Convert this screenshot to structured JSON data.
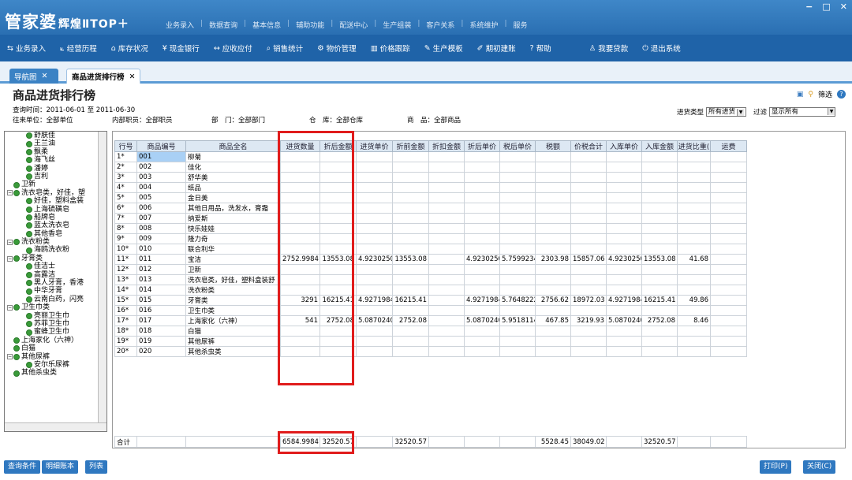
{
  "app": {
    "logo_main": "管家婆",
    "logo_sub": "辉煌ⅡTOP＋",
    "window_controls": [
      "−",
      "□",
      "✕"
    ]
  },
  "top_menu": [
    "业务录入",
    "数据查询",
    "基本信息",
    "辅助功能",
    "配送中心",
    "生产组装",
    "客户关系",
    "系统维护",
    "服务"
  ],
  "toolbar": [
    {
      "icon": "transfer-icon",
      "glyph": "⇆",
      "label": "业务录入"
    },
    {
      "icon": "chart-icon",
      "glyph": "⟀",
      "label": "经营历程"
    },
    {
      "icon": "home-icon",
      "glyph": "⌂",
      "label": "库存状况"
    },
    {
      "icon": "yen-icon",
      "glyph": "¥",
      "label": "现金银行"
    },
    {
      "icon": "arrows-icon",
      "glyph": "↔",
      "label": "应收应付"
    },
    {
      "icon": "search-icon",
      "glyph": "⌕",
      "label": "销售统计"
    },
    {
      "icon": "gear-icon",
      "glyph": "⚙",
      "label": "物价管理"
    },
    {
      "icon": "bar-chart-icon",
      "glyph": "▥",
      "label": "价格跟踪"
    },
    {
      "icon": "wrench-icon",
      "glyph": "✎",
      "label": "生产模板"
    },
    {
      "icon": "edit-icon",
      "glyph": "✐",
      "label": "期初建账"
    },
    {
      "icon": "help-icon",
      "glyph": "?",
      "label": "帮助"
    },
    {
      "icon": "user-icon",
      "glyph": "♙",
      "label": "我要贷款"
    },
    {
      "icon": "power-icon",
      "glyph": "⏻",
      "label": "退出系统"
    }
  ],
  "tabs": [
    {
      "label": "导航图",
      "close": "✕"
    },
    {
      "label": "商品进货排行榜",
      "close": "✕"
    }
  ],
  "page": {
    "title": "商品进货排行榜",
    "query_time": "查询时间：2011-06-01 至 2011-06-30",
    "partner": "往来单位：全部单位",
    "staff": "内部职员：全部职员",
    "dept": "部　门：全部部门",
    "warehouse": "仓　库：全部仓库",
    "goods": "商　品：全部商品",
    "filter_label": "筛选",
    "purchase_type_label": "进货类型",
    "purchase_type_value": "所有进货",
    "filter2_label": "过滤",
    "filter2_value": "显示所有"
  },
  "tree": [
    {
      "label": "舒肤佳",
      "indent": 3
    },
    {
      "label": "王兰油",
      "indent": 3
    },
    {
      "label": "飘柔",
      "indent": 3
    },
    {
      "label": "海飞丝",
      "indent": 3
    },
    {
      "label": "潘婷",
      "indent": 3
    },
    {
      "label": "吉利",
      "indent": 3
    },
    {
      "label": "卫新",
      "indent": 1
    },
    {
      "label": "洗衣皂类，好佳，塑",
      "indent": 0,
      "exp": "−"
    },
    {
      "label": "好佳，塑料盒装",
      "indent": 3
    },
    {
      "label": "上海硫磺皂",
      "indent": 3
    },
    {
      "label": "船牌皂",
      "indent": 3
    },
    {
      "label": "蓝太洗衣皂",
      "indent": 3
    },
    {
      "label": "其他香皂",
      "indent": 3
    },
    {
      "label": "洗衣粉类",
      "indent": 0,
      "exp": "−"
    },
    {
      "label": "海鸥洗衣粉",
      "indent": 3
    },
    {
      "label": "牙膏类",
      "indent": 0,
      "exp": "−"
    },
    {
      "label": "佳洁士",
      "indent": 3
    },
    {
      "label": "高露洁",
      "indent": 3
    },
    {
      "label": "黑人牙膏，香港",
      "indent": 3
    },
    {
      "label": "中华牙膏",
      "indent": 3
    },
    {
      "label": "云南白药，闪亮",
      "indent": 3
    },
    {
      "label": "卫生巾类",
      "indent": 0,
      "exp": "−"
    },
    {
      "label": "亮丽卫生巾",
      "indent": 3
    },
    {
      "label": "苏菲卫生巾",
      "indent": 3
    },
    {
      "label": "蜜蜂卫生巾",
      "indent": 3
    },
    {
      "label": "上海家化（六神）",
      "indent": 1
    },
    {
      "label": "白猫",
      "indent": 1
    },
    {
      "label": "其他尿裤",
      "indent": 0,
      "exp": "−"
    },
    {
      "label": "安尔乐尿裤",
      "indent": 3
    },
    {
      "label": "其他杀虫类",
      "indent": 1
    }
  ],
  "grid": {
    "columns": [
      "行号",
      "商品编号",
      "商品全名",
      "进货数量",
      "折后金额",
      "进货单价",
      "折前金额",
      "折扣金额",
      "折后单价",
      "税后单价",
      "税额",
      "价税合计",
      "入库单价",
      "入库金额",
      "进货比重(",
      "运费"
    ],
    "rows": [
      [
        "1*",
        "001",
        "柳菊",
        "",
        "",
        "",
        "",
        "",
        "",
        "",
        "",
        "",
        "",
        "",
        "",
        ""
      ],
      [
        "2*",
        "002",
        "佳化",
        "",
        "",
        "",
        "",
        "",
        "",
        "",
        "",
        "",
        "",
        "",
        "",
        ""
      ],
      [
        "3*",
        "003",
        "舒华美",
        "",
        "",
        "",
        "",
        "",
        "",
        "",
        "",
        "",
        "",
        "",
        "",
        ""
      ],
      [
        "4*",
        "004",
        "纸品",
        "",
        "",
        "",
        "",
        "",
        "",
        "",
        "",
        "",
        "",
        "",
        "",
        ""
      ],
      [
        "5*",
        "005",
        "金日美",
        "",
        "",
        "",
        "",
        "",
        "",
        "",
        "",
        "",
        "",
        "",
        "",
        ""
      ],
      [
        "6*",
        "006",
        "其他日用品，洗发水，膏霜",
        "",
        "",
        "",
        "",
        "",
        "",
        "",
        "",
        "",
        "",
        "",
        "",
        ""
      ],
      [
        "7*",
        "007",
        "纳爱斯",
        "",
        "",
        "",
        "",
        "",
        "",
        "",
        "",
        "",
        "",
        "",
        "",
        ""
      ],
      [
        "8*",
        "008",
        "快乐娃娃",
        "",
        "",
        "",
        "",
        "",
        "",
        "",
        "",
        "",
        "",
        "",
        "",
        ""
      ],
      [
        "9*",
        "009",
        "隆力奇",
        "",
        "",
        "",
        "",
        "",
        "",
        "",
        "",
        "",
        "",
        "",
        "",
        ""
      ],
      [
        "10*",
        "010",
        "联合利华",
        "",
        "",
        "",
        "",
        "",
        "",
        "",
        "",
        "",
        "",
        "",
        "",
        ""
      ],
      [
        "11*",
        "011",
        "宝洁",
        "2752.9984",
        "13553.08",
        "4.92302502",
        "13553.08",
        "",
        "4.92302502",
        "5.75992343",
        "2303.98",
        "15857.06",
        "4.92302502",
        "13553.08",
        "41.68",
        ""
      ],
      [
        "12*",
        "012",
        "卫新",
        "",
        "",
        "",
        "",
        "",
        "",
        "",
        "",
        "",
        "",
        "",
        "",
        ""
      ],
      [
        "13*",
        "013",
        "洗衣皂类，好佳，塑料盒装舒",
        "",
        "",
        "",
        "",
        "",
        "",
        "",
        "",
        "",
        "",
        "",
        "",
        ""
      ],
      [
        "14*",
        "014",
        "洗衣粉类",
        "",
        "",
        "",
        "",
        "",
        "",
        "",
        "",
        "",
        "",
        "",
        "",
        ""
      ],
      [
        "15*",
        "015",
        "牙膏类",
        "3291",
        "16215.41",
        "4.92719842",
        "16215.41",
        "",
        "4.92719842",
        "5.76482224",
        "2756.62",
        "18972.03",
        "4.92719842",
        "16215.41",
        "49.86",
        ""
      ],
      [
        "16*",
        "016",
        "卫生巾类",
        "",
        "",
        "",
        "",
        "",
        "",
        "",
        "",
        "",
        "",
        "",
        "",
        ""
      ],
      [
        "17*",
        "017",
        "上海家化（六神）",
        "541",
        "2752.08",
        "5.08702403",
        "2752.08",
        "",
        "5.08702403",
        "5.95181146",
        "467.85",
        "3219.93",
        "5.08702403",
        "2752.08",
        "8.46",
        ""
      ],
      [
        "18*",
        "018",
        "白猫",
        "",
        "",
        "",
        "",
        "",
        "",
        "",
        "",
        "",
        "",
        "",
        "",
        ""
      ],
      [
        "19*",
        "019",
        "其他尿裤",
        "",
        "",
        "",
        "",
        "",
        "",
        "",
        "",
        "",
        "",
        "",
        "",
        ""
      ],
      [
        "20*",
        "020",
        "其他杀虫类",
        "",
        "",
        "",
        "",
        "",
        "",
        "",
        "",
        "",
        "",
        "",
        "",
        ""
      ]
    ],
    "total": [
      "合计",
      "",
      "",
      "6584.9984",
      "32520.57",
      "",
      "32520.57",
      "",
      "",
      "",
      "5528.45",
      "38049.02",
      "",
      "32520.57",
      "",
      ""
    ]
  },
  "bottom_buttons": [
    "查询条件",
    "明细账本",
    "列表"
  ],
  "bottom_right_buttons": [
    "打印(P)",
    "关闭(C)"
  ]
}
